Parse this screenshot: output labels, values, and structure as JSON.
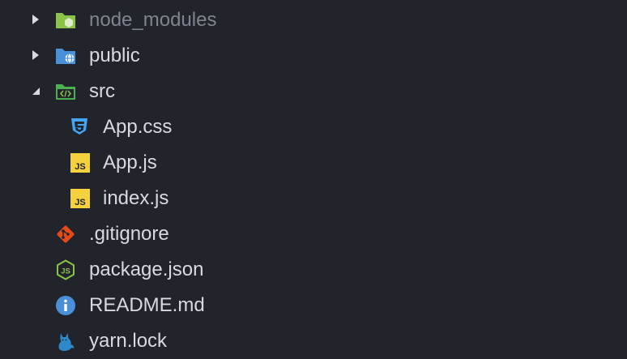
{
  "explorer": {
    "items": [
      {
        "label": "node_modules",
        "icon": "folder-node-icon",
        "kind": "folder",
        "expanded": false,
        "dimmed": true
      },
      {
        "label": "public",
        "icon": "folder-public-icon",
        "kind": "folder",
        "expanded": false
      },
      {
        "label": "src",
        "icon": "folder-src-icon",
        "kind": "folder",
        "expanded": true
      },
      {
        "label": "App.css",
        "icon": "css-file-icon",
        "kind": "file"
      },
      {
        "label": "App.js",
        "icon": "js-file-icon",
        "kind": "file"
      },
      {
        "label": "index.js",
        "icon": "js-file-icon",
        "kind": "file"
      },
      {
        "label": ".gitignore",
        "icon": "git-icon",
        "kind": "file"
      },
      {
        "label": "package.json",
        "icon": "nodejs-icon",
        "kind": "file"
      },
      {
        "label": "README.md",
        "icon": "info-icon",
        "kind": "file"
      },
      {
        "label": "yarn.lock",
        "icon": "yarn-cat-icon",
        "kind": "file"
      }
    ]
  },
  "colors": {
    "background": "#21252b",
    "text": "#d7dae0",
    "text_dimmed": "#7f848e",
    "css_blue": "#42a5f5",
    "js_yellow": "#f5d13d",
    "git_orange": "#e64a19",
    "node_green": "#8bc34a",
    "info_blue": "#4a90d9",
    "yarn_blue": "#2f88c8"
  }
}
